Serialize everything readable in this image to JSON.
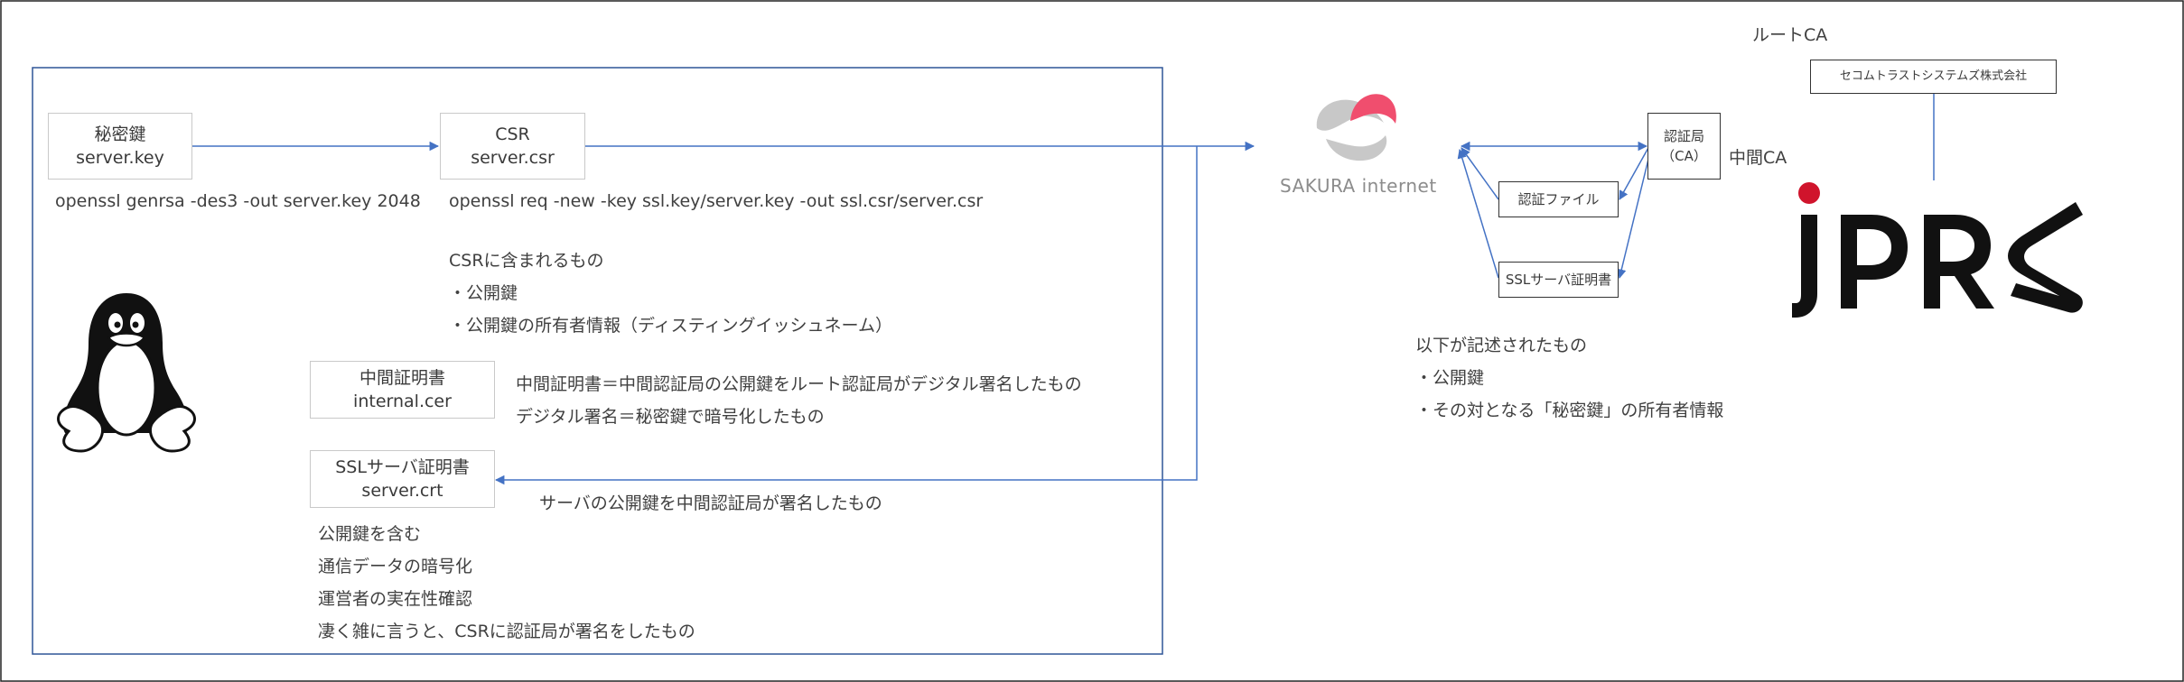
{
  "colors": {
    "arrow": "#4472c4",
    "frame": "#2f5597",
    "sakura_pink": "#f04e6e",
    "sakura_gray": "#c8c8c8",
    "jprs_red": "#d0142c",
    "jprs_black": "#111111"
  },
  "left_panel": {
    "private_key_box": {
      "line1": "秘密鍵",
      "line2": "server.key"
    },
    "csr_box": {
      "line1": "CSR",
      "line2": "server.csr"
    },
    "cmd_genrsa": "openssl genrsa -des3 -out server.key 2048",
    "cmd_req": "openssl req -new -key ssl.key/server.key -out ssl.csr/server.csr",
    "csr_contents": {
      "title": "CSRに含まれるもの",
      "items": [
        "・公開鍵",
        "・公開鍵の所有者情報（ディスティングイッシュネーム）"
      ]
    },
    "intermediate_box": {
      "line1": "中間証明書",
      "line2": "internal.cer"
    },
    "intermediate_notes": [
      "中間証明書＝中間認証局の公開鍵をルート認証局がデジタル署名したもの",
      "デジタル署名＝秘密鍵で暗号化したもの"
    ],
    "ssl_box": {
      "line1": "SSLサーバ証明書",
      "line2": "server.crt"
    },
    "ssl_note": "サーバの公開鍵を中間認証局が署名したもの",
    "ssl_points": [
      "公開鍵を含む",
      "通信データの暗号化",
      "運営者の実在性確認",
      "凄く雑に言うと、CSRに認証局が署名をしたもの"
    ],
    "linux_icon": "tux-penguin-icon"
  },
  "sakura": {
    "logo_text": "SAKURA internet",
    "icon": "sakura-logo-icon"
  },
  "ca_area": {
    "ca_box": {
      "line1": "認証局",
      "line2": "（CA）"
    },
    "auth_file_box": "認証ファイル",
    "ssl_cert_box": "SSLサーバ証明書",
    "intermediate_ca_label": "中間CA",
    "root_ca_label": "ルートCA",
    "secom_box": "セコムトラストシステムズ株式会社",
    "jprs_logo": {
      "text": "JPRS",
      "icon": "jprs-logo-icon"
    },
    "description": {
      "title": "以下が記述されたもの",
      "items": [
        "・公開鍵",
        "・その対となる「秘密鍵」の所有者情報"
      ]
    }
  }
}
